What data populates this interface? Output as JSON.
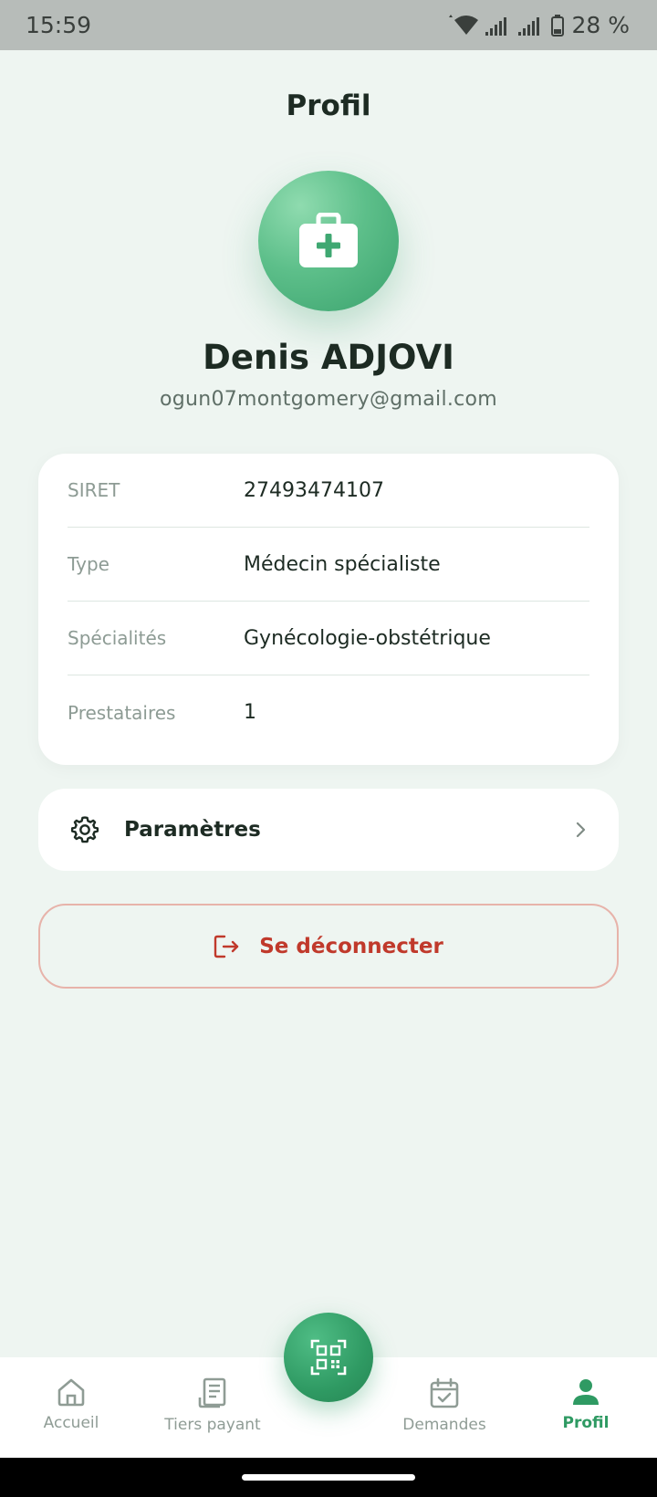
{
  "status_bar": {
    "time": "15:59",
    "battery": "28 %"
  },
  "header": {
    "title": "Profil"
  },
  "profile": {
    "avatar_icon": "medical-bag-icon",
    "name": "Denis ADJOVI",
    "email": "ogun07montgomery@gmail.com"
  },
  "info": {
    "rows": [
      {
        "label": "SIRET",
        "value": "27493474107"
      },
      {
        "label": "Type",
        "value": "Médecin spécialiste"
      },
      {
        "label": "Spécialités",
        "value": "Gynécologie-obstétrique"
      },
      {
        "label": "Prestataires",
        "value": "1"
      }
    ]
  },
  "settings": {
    "label": "Paramètres",
    "icon": "gear-icon"
  },
  "logout": {
    "label": "Se déconnecter",
    "icon": "logout-icon"
  },
  "nav": {
    "items": [
      {
        "label": "Accueil",
        "icon": "home-icon"
      },
      {
        "label": "Tiers payant",
        "icon": "receipt-icon"
      },
      {
        "label": "Demandes",
        "icon": "calendar-check-icon"
      },
      {
        "label": "Profil",
        "icon": "user-icon"
      }
    ],
    "fab_icon": "qr-code-icon"
  },
  "colors": {
    "accent": "#2f9a63",
    "danger": "#c0392b",
    "background": "#eef5f1"
  }
}
